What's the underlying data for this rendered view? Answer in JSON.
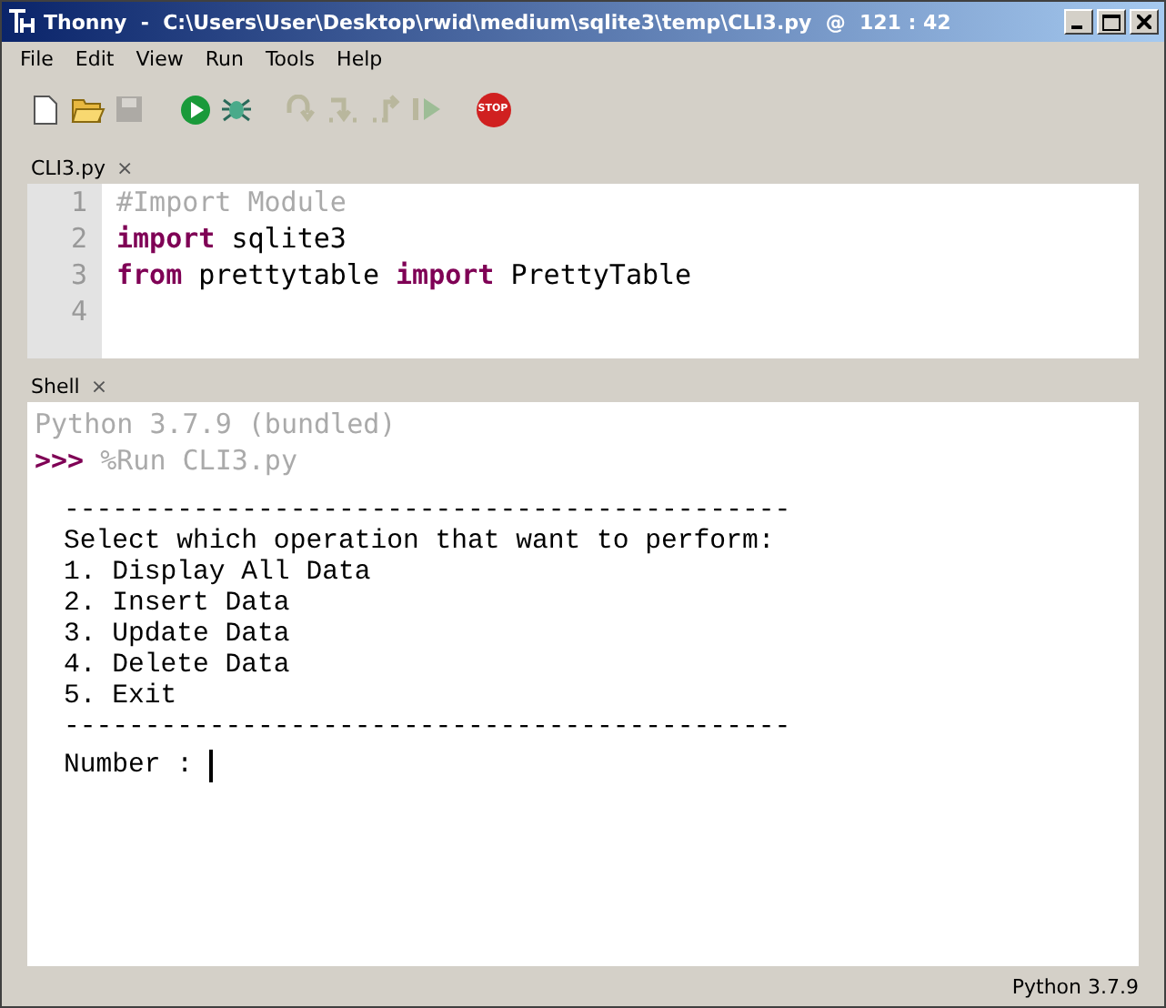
{
  "window": {
    "title": "Thonny  -  C:\\Users\\User\\Desktop\\rwid\\medium\\sqlite3\\temp\\CLI3.py  @  121 : 42"
  },
  "menu": [
    "File",
    "Edit",
    "View",
    "Run",
    "Tools",
    "Help"
  ],
  "toolbar": [
    {
      "kind": "new",
      "disabled": false
    },
    {
      "kind": "open",
      "disabled": false
    },
    {
      "kind": "save",
      "disabled": true
    },
    {
      "kind": "gap"
    },
    {
      "kind": "run",
      "disabled": false
    },
    {
      "kind": "debug",
      "disabled": false
    },
    {
      "kind": "gap"
    },
    {
      "kind": "step-over",
      "disabled": true
    },
    {
      "kind": "step-into",
      "disabled": true
    },
    {
      "kind": "step-out",
      "disabled": true
    },
    {
      "kind": "resume",
      "disabled": true
    },
    {
      "kind": "gap"
    },
    {
      "kind": "stop",
      "disabled": false,
      "label": "STOP"
    }
  ],
  "editor": {
    "tab": {
      "label": "CLI3.py",
      "close": "×"
    },
    "lines": [
      {
        "number": "1",
        "tokens": [
          {
            "kind": "comment",
            "text": "#Import Module"
          }
        ]
      },
      {
        "number": "2",
        "tokens": [
          {
            "kind": "keyword",
            "text": "import"
          },
          {
            "kind": "plain",
            "text": " sqlite3"
          }
        ]
      },
      {
        "number": "3",
        "tokens": [
          {
            "kind": "keyword",
            "text": "from"
          },
          {
            "kind": "plain",
            "text": " prettytable "
          },
          {
            "kind": "keyword",
            "text": "import"
          },
          {
            "kind": "plain",
            "text": " PrettyTable"
          }
        ]
      },
      {
        "number": "4"
      }
    ]
  },
  "shell": {
    "tab": {
      "label": "Shell",
      "close": "×"
    },
    "banner": "Python 3.7.9 (bundled)",
    "prompt": ">>>",
    "command": "%Run CLI3.py",
    "output": [
      "---------------------------------------------",
      "Select which operation that want to perform:",
      "1. Display All Data",
      "2. Insert Data",
      "3. Update Data",
      "4. Delete Data",
      "5. Exit",
      "---------------------------------------------"
    ],
    "input_label": "Number :"
  },
  "status_bar": "Python 3.7.9"
}
